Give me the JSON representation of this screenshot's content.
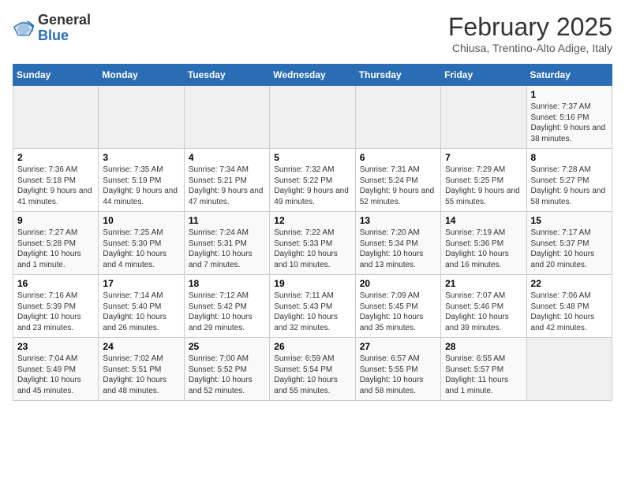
{
  "header": {
    "logo_general": "General",
    "logo_blue": "Blue",
    "month_title": "February 2025",
    "subtitle": "Chiusa, Trentino-Alto Adige, Italy"
  },
  "weekdays": [
    "Sunday",
    "Monday",
    "Tuesday",
    "Wednesday",
    "Thursday",
    "Friday",
    "Saturday"
  ],
  "weeks": [
    [
      {
        "day": "",
        "info": ""
      },
      {
        "day": "",
        "info": ""
      },
      {
        "day": "",
        "info": ""
      },
      {
        "day": "",
        "info": ""
      },
      {
        "day": "",
        "info": ""
      },
      {
        "day": "",
        "info": ""
      },
      {
        "day": "1",
        "info": "Sunrise: 7:37 AM\nSunset: 5:16 PM\nDaylight: 9 hours and 38 minutes."
      }
    ],
    [
      {
        "day": "2",
        "info": "Sunrise: 7:36 AM\nSunset: 5:18 PM\nDaylight: 9 hours and 41 minutes."
      },
      {
        "day": "3",
        "info": "Sunrise: 7:35 AM\nSunset: 5:19 PM\nDaylight: 9 hours and 44 minutes."
      },
      {
        "day": "4",
        "info": "Sunrise: 7:34 AM\nSunset: 5:21 PM\nDaylight: 9 hours and 47 minutes."
      },
      {
        "day": "5",
        "info": "Sunrise: 7:32 AM\nSunset: 5:22 PM\nDaylight: 9 hours and 49 minutes."
      },
      {
        "day": "6",
        "info": "Sunrise: 7:31 AM\nSunset: 5:24 PM\nDaylight: 9 hours and 52 minutes."
      },
      {
        "day": "7",
        "info": "Sunrise: 7:29 AM\nSunset: 5:25 PM\nDaylight: 9 hours and 55 minutes."
      },
      {
        "day": "8",
        "info": "Sunrise: 7:28 AM\nSunset: 5:27 PM\nDaylight: 9 hours and 58 minutes."
      }
    ],
    [
      {
        "day": "9",
        "info": "Sunrise: 7:27 AM\nSunset: 5:28 PM\nDaylight: 10 hours and 1 minute."
      },
      {
        "day": "10",
        "info": "Sunrise: 7:25 AM\nSunset: 5:30 PM\nDaylight: 10 hours and 4 minutes."
      },
      {
        "day": "11",
        "info": "Sunrise: 7:24 AM\nSunset: 5:31 PM\nDaylight: 10 hours and 7 minutes."
      },
      {
        "day": "12",
        "info": "Sunrise: 7:22 AM\nSunset: 5:33 PM\nDaylight: 10 hours and 10 minutes."
      },
      {
        "day": "13",
        "info": "Sunrise: 7:20 AM\nSunset: 5:34 PM\nDaylight: 10 hours and 13 minutes."
      },
      {
        "day": "14",
        "info": "Sunrise: 7:19 AM\nSunset: 5:36 PM\nDaylight: 10 hours and 16 minutes."
      },
      {
        "day": "15",
        "info": "Sunrise: 7:17 AM\nSunset: 5:37 PM\nDaylight: 10 hours and 20 minutes."
      }
    ],
    [
      {
        "day": "16",
        "info": "Sunrise: 7:16 AM\nSunset: 5:39 PM\nDaylight: 10 hours and 23 minutes."
      },
      {
        "day": "17",
        "info": "Sunrise: 7:14 AM\nSunset: 5:40 PM\nDaylight: 10 hours and 26 minutes."
      },
      {
        "day": "18",
        "info": "Sunrise: 7:12 AM\nSunset: 5:42 PM\nDaylight: 10 hours and 29 minutes."
      },
      {
        "day": "19",
        "info": "Sunrise: 7:11 AM\nSunset: 5:43 PM\nDaylight: 10 hours and 32 minutes."
      },
      {
        "day": "20",
        "info": "Sunrise: 7:09 AM\nSunset: 5:45 PM\nDaylight: 10 hours and 35 minutes."
      },
      {
        "day": "21",
        "info": "Sunrise: 7:07 AM\nSunset: 5:46 PM\nDaylight: 10 hours and 39 minutes."
      },
      {
        "day": "22",
        "info": "Sunrise: 7:06 AM\nSunset: 5:48 PM\nDaylight: 10 hours and 42 minutes."
      }
    ],
    [
      {
        "day": "23",
        "info": "Sunrise: 7:04 AM\nSunset: 5:49 PM\nDaylight: 10 hours and 45 minutes."
      },
      {
        "day": "24",
        "info": "Sunrise: 7:02 AM\nSunset: 5:51 PM\nDaylight: 10 hours and 48 minutes."
      },
      {
        "day": "25",
        "info": "Sunrise: 7:00 AM\nSunset: 5:52 PM\nDaylight: 10 hours and 52 minutes."
      },
      {
        "day": "26",
        "info": "Sunrise: 6:59 AM\nSunset: 5:54 PM\nDaylight: 10 hours and 55 minutes."
      },
      {
        "day": "27",
        "info": "Sunrise: 6:57 AM\nSunset: 5:55 PM\nDaylight: 10 hours and 58 minutes."
      },
      {
        "day": "28",
        "info": "Sunrise: 6:55 AM\nSunset: 5:57 PM\nDaylight: 11 hours and 1 minute."
      },
      {
        "day": "",
        "info": ""
      }
    ]
  ]
}
